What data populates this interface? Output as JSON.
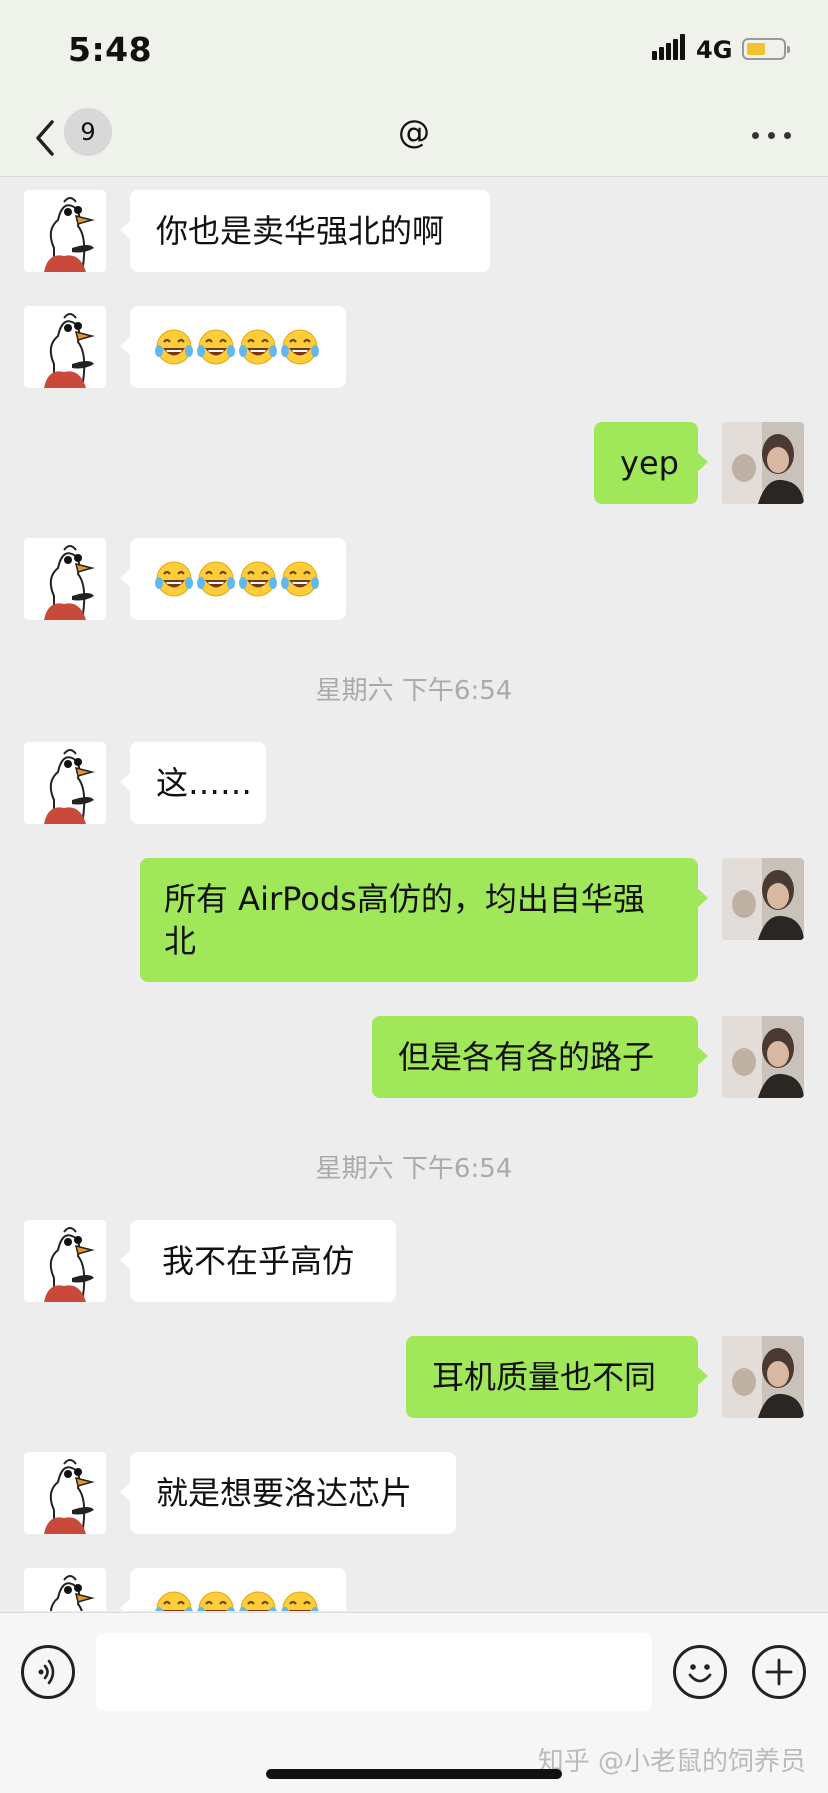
{
  "status_bar": {
    "time": "5:48",
    "network": "4G"
  },
  "header": {
    "unread_count": "9",
    "title": "@"
  },
  "messages": [
    {
      "side": "in",
      "text": "你也是卖华强北的啊"
    },
    {
      "side": "in",
      "text": "😂😂😂😂"
    },
    {
      "side": "out",
      "text": "yep"
    },
    {
      "side": "in",
      "text": "😂😂😂😂"
    },
    {
      "type": "time",
      "text": "星期六 下午6:54"
    },
    {
      "side": "in",
      "text": "这……"
    },
    {
      "side": "out",
      "line1": "所有 AirPods高仿的，均出自华强",
      "line2": "北"
    },
    {
      "side": "out",
      "text": "但是各有各的路子"
    },
    {
      "type": "time",
      "text": "星期六 下午6:54"
    },
    {
      "side": "in",
      "text": "我不在乎高仿"
    },
    {
      "side": "out",
      "text": "耳机质量也不同"
    },
    {
      "side": "in",
      "text": "就是想要洛达芯片"
    },
    {
      "side": "in",
      "text": "😂😂😂😂"
    }
  ],
  "input_bar": {
    "placeholder": ""
  },
  "watermark": "知乎 @小老鼠的饲养员",
  "colors": {
    "outgoing_bubble": "#a0e75a",
    "incoming_bubble": "#ffffff",
    "background": "#ededed"
  },
  "icons": [
    "back-chevron-icon",
    "more-icon",
    "voice-icon",
    "emoji-icon",
    "plus-icon"
  ]
}
